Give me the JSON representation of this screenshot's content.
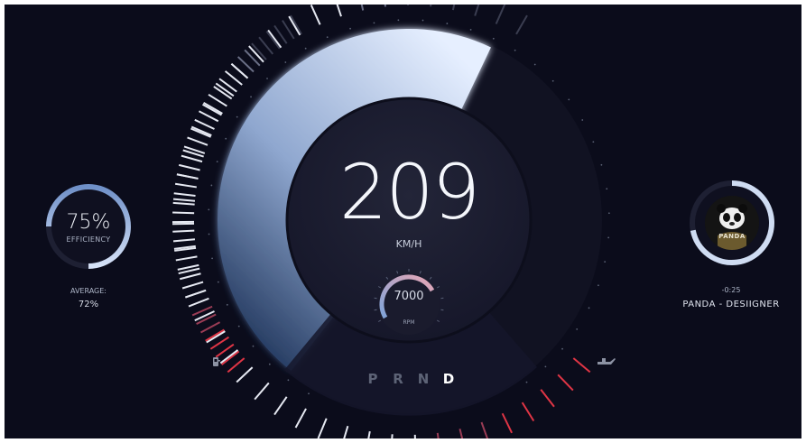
{
  "speed": {
    "value": "209",
    "unit": "KM/H",
    "level": 0.62
  },
  "rpm": {
    "value": "7000",
    "unit": "RPM"
  },
  "efficiency": {
    "value": "75%",
    "label": "EFFICIENCY",
    "average_label": "AVERAGE:",
    "average_value": "72%",
    "ring_fraction": 0.75
  },
  "fuel_level": 0.9,
  "oil_level": 0.9,
  "gear": {
    "options": [
      "P",
      "R",
      "N",
      "D"
    ],
    "selected": "D"
  },
  "music": {
    "album_art_text": "PANDA",
    "time_remaining": "-0:25",
    "title": "PANDA - DESIIGNER",
    "progress": 0.72
  },
  "icons": {
    "fuel": "fuel-pump-icon",
    "oil": "oil-can-icon"
  },
  "colors": {
    "background": "#0b0c1b",
    "arc_light": "#d9e6fa",
    "arc_dark": "#2a4270",
    "warning": "#d63a4a",
    "accent": "#8fb6e8"
  }
}
